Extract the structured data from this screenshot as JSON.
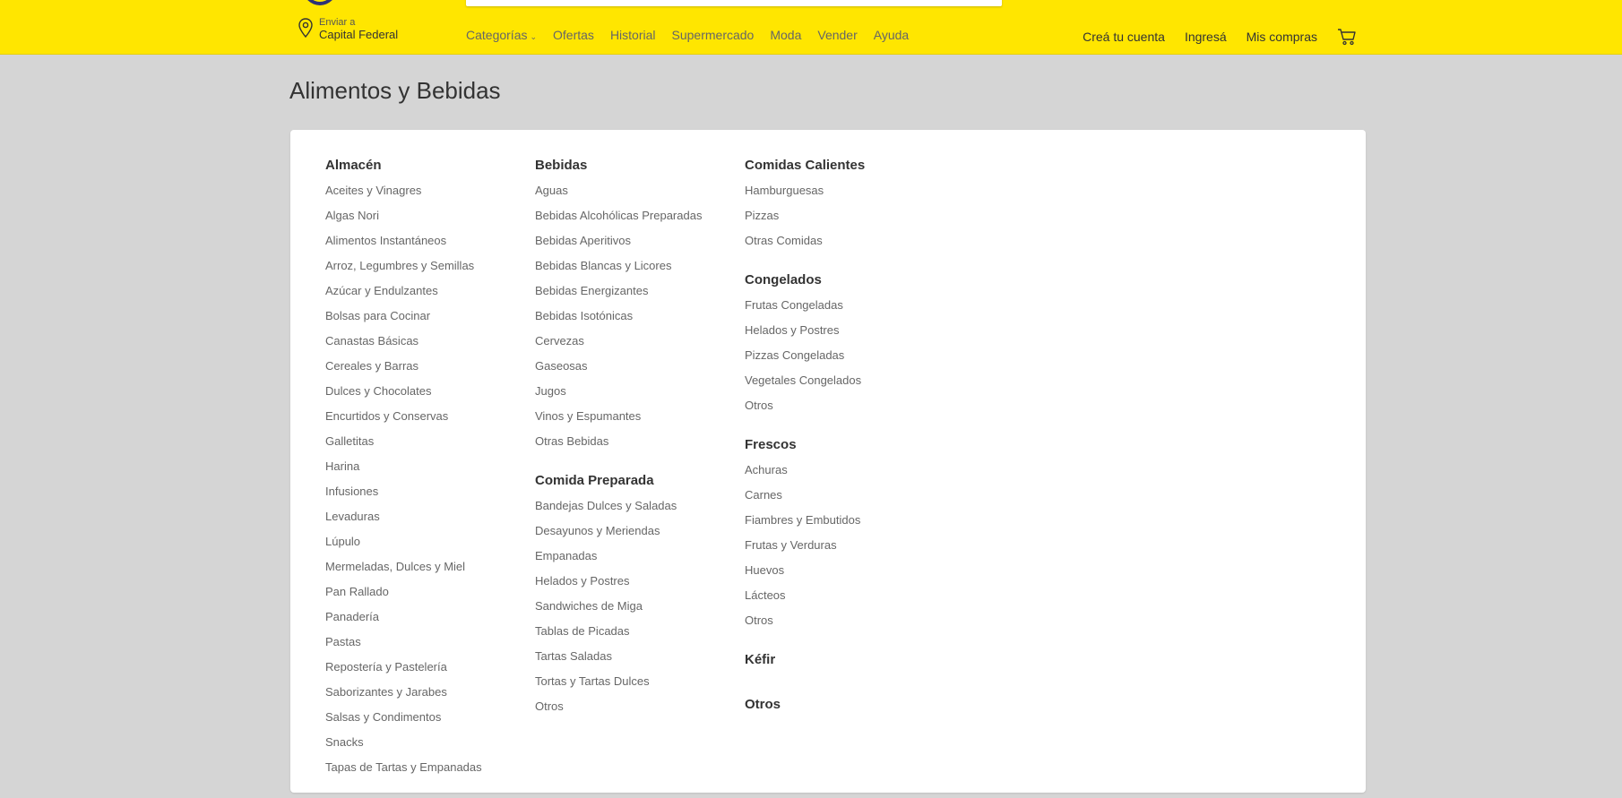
{
  "header": {
    "location_small": "Enviar a",
    "location_big": "Capital Federal",
    "nav": [
      {
        "label": "Categorías",
        "has_chevron": true
      },
      {
        "label": "Ofertas"
      },
      {
        "label": "Historial"
      },
      {
        "label": "Supermercado"
      },
      {
        "label": "Moda"
      },
      {
        "label": "Vender"
      },
      {
        "label": "Ayuda"
      }
    ],
    "user_nav": [
      "Creá tu cuenta",
      "Ingresá",
      "Mis compras"
    ],
    "cart_icon": "cart-icon",
    "pin_icon": "location-pin-icon",
    "brand_color": "#ffe600"
  },
  "page": {
    "title": "Alimentos y Bebidas"
  },
  "columns": [
    [
      {
        "title": "Almacén",
        "items": [
          "Aceites y Vinagres",
          "Algas Nori",
          "Alimentos Instantáneos",
          "Arroz, Legumbres y Semillas",
          "Azúcar y Endulzantes",
          "Bolsas para Cocinar",
          "Canastas Básicas",
          "Cereales y Barras",
          "Dulces y Chocolates",
          "Encurtidos y Conservas",
          "Galletitas",
          "Harina",
          "Infusiones",
          "Levaduras",
          "Lúpulo",
          "Mermeladas, Dulces y Miel",
          "Pan Rallado",
          "Panadería",
          "Pastas",
          "Repostería y Pastelería",
          "Saborizantes y Jarabes",
          "Salsas y Condimentos",
          "Snacks",
          "Tapas de Tartas y Empanadas"
        ]
      }
    ],
    [
      {
        "title": "Bebidas",
        "items": [
          "Aguas",
          "Bebidas Alcohólicas Preparadas",
          "Bebidas Aperitivos",
          "Bebidas Blancas y Licores",
          "Bebidas Energizantes",
          "Bebidas Isotónicas",
          "Cervezas",
          "Gaseosas",
          "Jugos",
          "Vinos y Espumantes",
          "Otras Bebidas"
        ]
      },
      {
        "title": "Comida Preparada",
        "items": [
          "Bandejas Dulces y Saladas",
          "Desayunos y Meriendas",
          "Empanadas",
          "Helados y Postres",
          "Sandwiches de Miga",
          "Tablas de Picadas",
          "Tartas Saladas",
          "Tortas y Tartas Dulces",
          "Otros"
        ]
      }
    ],
    [
      {
        "title": "Comidas Calientes",
        "items": [
          "Hamburguesas",
          "Pizzas",
          "Otras Comidas"
        ]
      },
      {
        "title": "Congelados",
        "items": [
          "Frutas Congeladas",
          "Helados y Postres",
          "Pizzas Congeladas",
          "Vegetales Congelados",
          "Otros"
        ]
      },
      {
        "title": "Frescos",
        "items": [
          "Achuras",
          "Carnes",
          "Fiambres y Embutidos",
          "Frutas y Verduras",
          "Huevos",
          "Lácteos",
          "Otros"
        ]
      },
      {
        "title": "Kéfir",
        "items": []
      },
      {
        "title": "Otros",
        "items": []
      }
    ]
  ]
}
